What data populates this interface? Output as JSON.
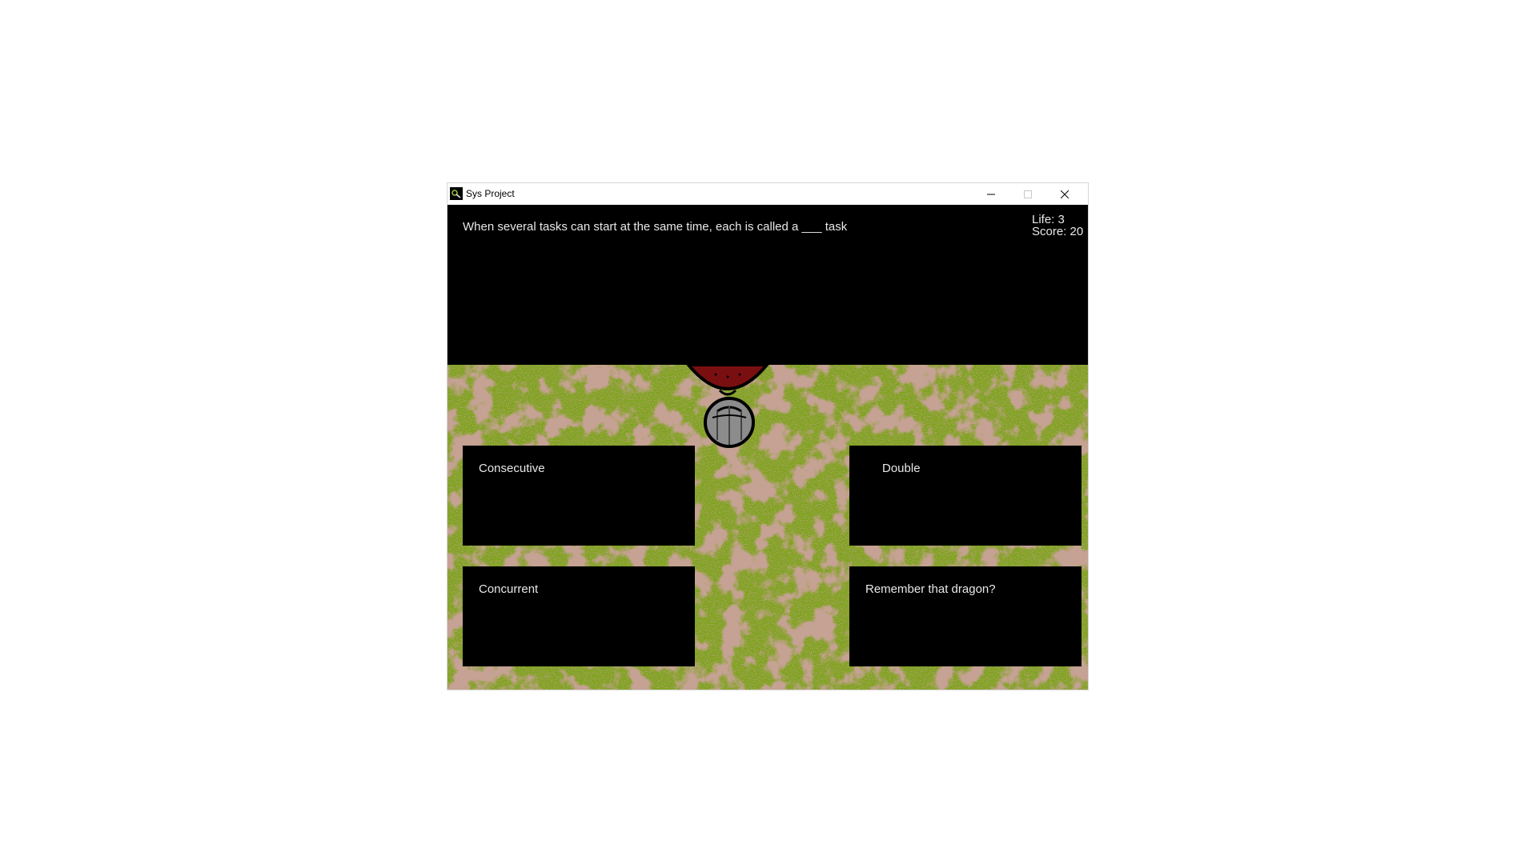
{
  "window": {
    "title": "Sys Project"
  },
  "hud": {
    "life_label": "Life: 3",
    "score_label": "Score: 20"
  },
  "question": {
    "text": "When several tasks can start at the same time, each is called a ___ task"
  },
  "answers": {
    "top_left": "Consecutive",
    "top_right": "Double",
    "bottom_left": "Concurrent",
    "bottom_right": "Remember that dragon?"
  },
  "colors": {
    "grass": "#7da31c",
    "dirt": "#8f5c4b",
    "panel": "#000000",
    "text": "#e8e8e8",
    "player_red": "#7a0f12",
    "player_gray": "#8c8c8c"
  },
  "icons": {
    "app": "game-app-icon",
    "minimize": "minimize-icon",
    "maximize": "maximize-icon",
    "close": "close-icon",
    "player": "player-sprite"
  }
}
